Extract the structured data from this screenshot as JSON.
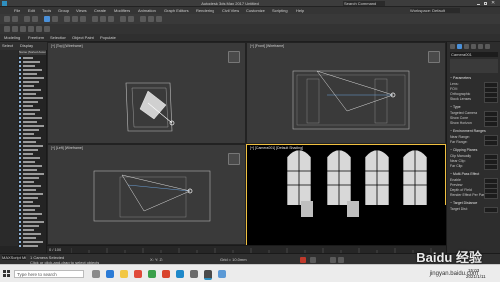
{
  "app": {
    "title": "Autodesk 3ds Max 2017    Untitled",
    "search_placeholder": "Search Command"
  },
  "menu": {
    "items": [
      "File",
      "Edit",
      "Tools",
      "Group",
      "Views",
      "Create",
      "Modifiers",
      "Animation",
      "Graph Editors",
      "Rendering",
      "Civil View",
      "Customize",
      "Scripting",
      "Help"
    ],
    "workspace": "Workspace: Default"
  },
  "ribbon": {
    "tabs": [
      "Modeling",
      "Freeform",
      "Selection",
      "Object Paint",
      "Populate"
    ]
  },
  "explorer": {
    "tabs": [
      "Select",
      "Display"
    ],
    "header": "Name (Sorted Ascending)",
    "row_count": 48
  },
  "viewports": {
    "top_left": {
      "label": "[+] [Top] [Wireframe]"
    },
    "top_right": {
      "label": "[+] [Front] [Wireframe]"
    },
    "bottom_left": {
      "label": "[+] [Left] [Wireframe]"
    },
    "bottom_right": {
      "label": "[+] [Camera001] [Default Shading]"
    }
  },
  "command_panel": {
    "object_name": "Camera001",
    "sections": [
      {
        "title": "Parameters",
        "rows": [
          "Lens:",
          "FOV:",
          "Orthographic",
          "Stock Lenses"
        ]
      },
      {
        "title": "Type",
        "rows": [
          "Targeted Camera",
          "Show Cone",
          "Show Horizon"
        ]
      },
      {
        "title": "Environment Ranges",
        "rows": [
          "Near Range:",
          "Far Range:"
        ]
      },
      {
        "title": "Clipping Planes",
        "rows": [
          "Clip Manually",
          "Near Clip:",
          "Far Clip:"
        ]
      },
      {
        "title": "Multi-Pass Effect",
        "rows": [
          "Enable",
          "Preview",
          "Depth of Field",
          "Render Effect Per Pass"
        ]
      },
      {
        "title": "Target Distance",
        "rows": [
          "Target Dist:"
        ]
      }
    ]
  },
  "timeline": {
    "frame": "0 / 100"
  },
  "status": {
    "selection": "1 Camera Selected",
    "prompt": "Click or click-and-drag to select objects",
    "coords_label": "X:  Y:  Z:",
    "grid": "Grid = 10.0mm",
    "maxscript": "MAXScript Mi"
  },
  "taskbar": {
    "search_placeholder": "Type here to search",
    "time": "15:03",
    "date": "2021/1/11"
  },
  "watermark": {
    "logo": "Baidu 经验",
    "url": "jingyan.baidu.com"
  },
  "colors": {
    "accent": "#4a90d9",
    "viewport_bg": "#3a3a3a",
    "camera_view_bg": "#000000",
    "active_border": "#f0c040"
  }
}
